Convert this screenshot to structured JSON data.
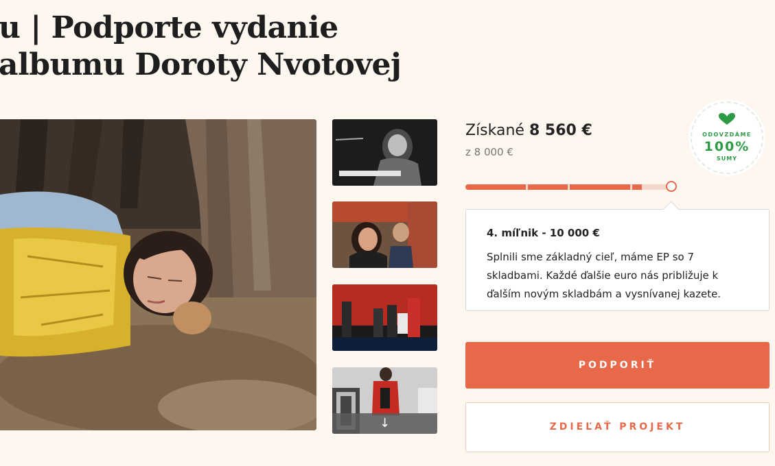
{
  "project": {
    "title_line1": "u | Podporte vydanie",
    "title_line2": "albumu Doroty Nvotovej"
  },
  "funding": {
    "raised_label": "Získané",
    "raised_amount": "8 560 €",
    "goal_text": "z 8 000 €",
    "progress_fraction": 0.856
  },
  "badge": {
    "line1": "ODOVZDÁME",
    "line2": "100%",
    "line3": "SUMY"
  },
  "milestone": {
    "title": "4. míľnik - 10 000 €",
    "description": "Splnili sme základný cieľ, máme EP so 7 skladbami. Každé ďalšie euro nás približuje k ďalším novým skladbám a vysnívanej kazete."
  },
  "gallery": {
    "more_arrow": "↓"
  },
  "buttons": {
    "support_label": "PODPORIŤ",
    "share_label": "ZDIEĽAŤ PROJEKT"
  },
  "colors": {
    "accent": "#e8694a",
    "badge_green": "#2d9a45",
    "background": "#fdf7ef"
  }
}
